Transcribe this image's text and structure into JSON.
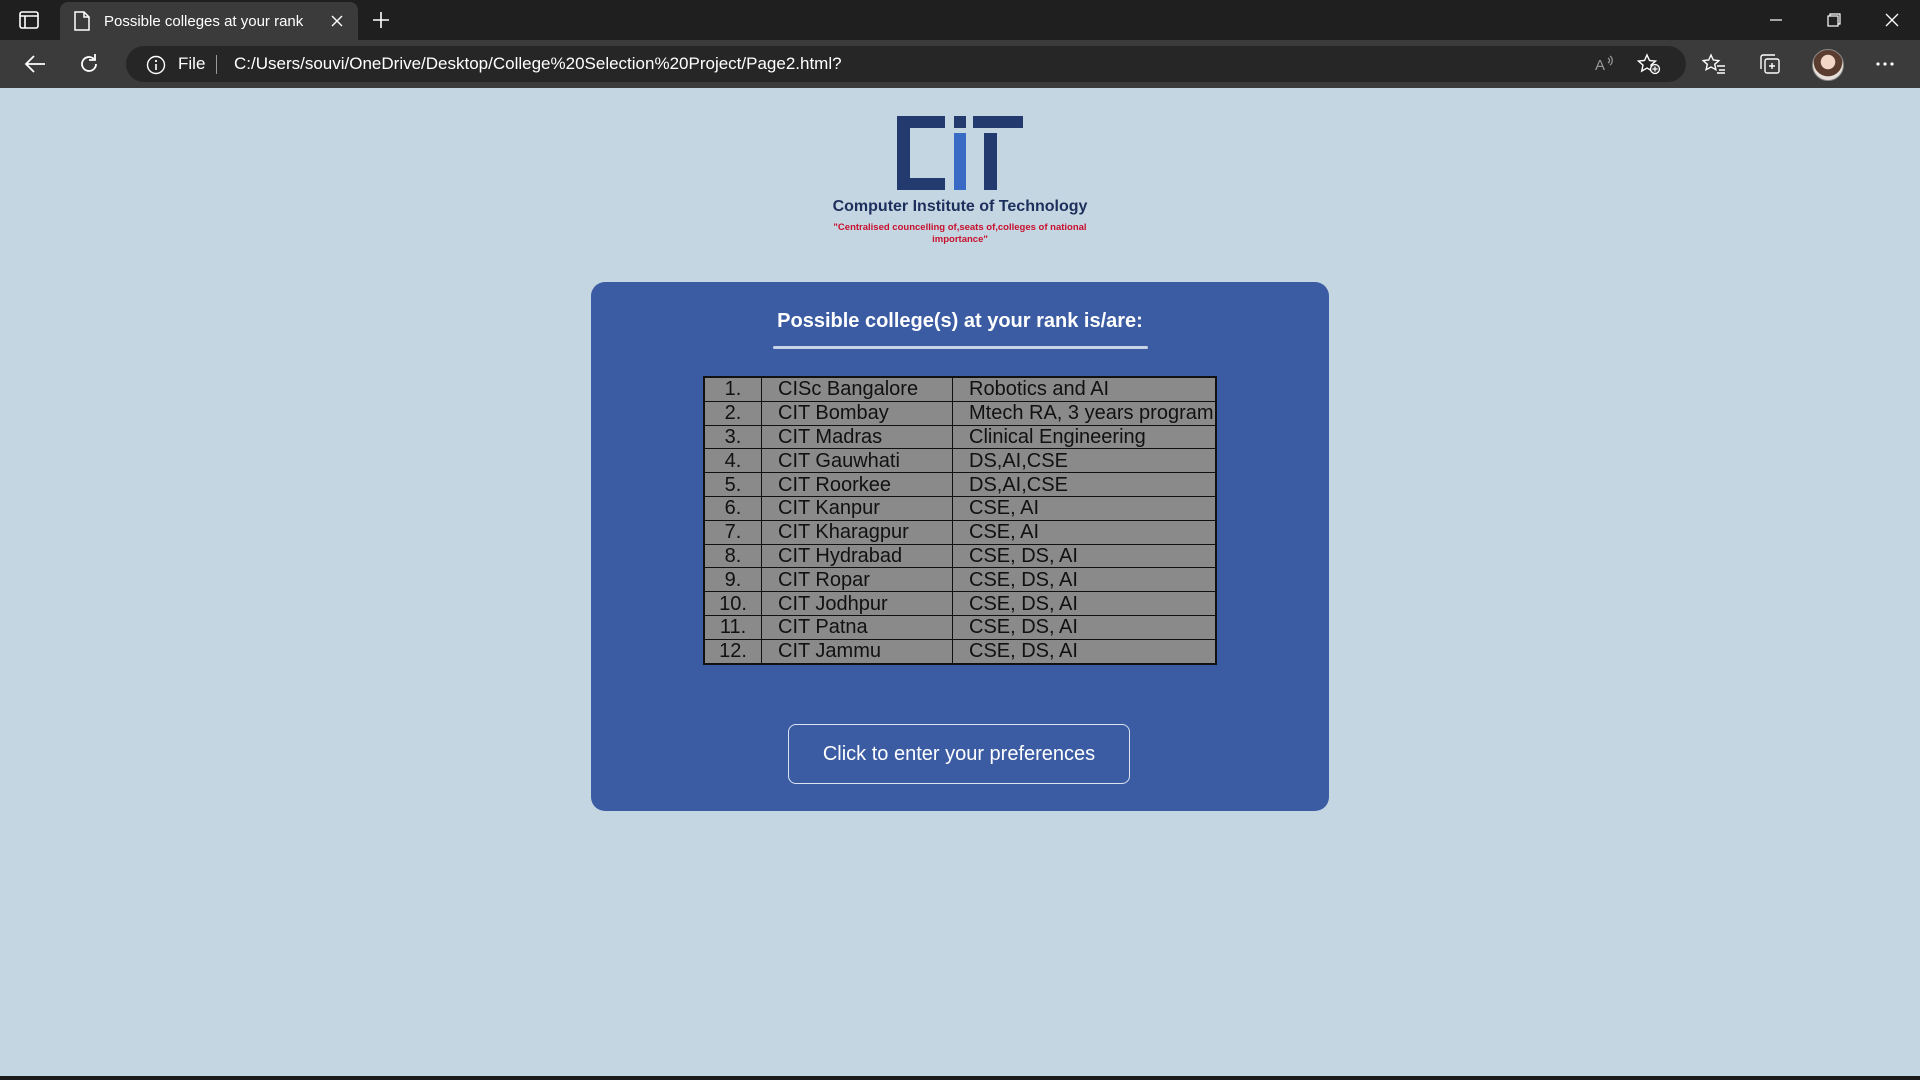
{
  "browser": {
    "tab_title": "Possible colleges at your rank",
    "address_prefix": "File",
    "url": "C:/Users/souvi/OneDrive/Desktop/College%20Selection%20Project/Page2.html?"
  },
  "logo": {
    "mark_color": "#233a6e",
    "name": "Computer Institute of Technology",
    "tagline": "\"Centralised councelling of,seats of,colleges of national importance\""
  },
  "card": {
    "heading": "Possible college(s) at your rank is/are:",
    "rows": [
      {
        "num": "1.",
        "college": "CISc Bangalore",
        "branch": "Robotics and AI"
      },
      {
        "num": "2.",
        "college": "CIT Bombay",
        "branch": "Mtech RA, 3 years program"
      },
      {
        "num": "3.",
        "college": "CIT Madras",
        "branch": "Clinical Engineering"
      },
      {
        "num": "4.",
        "college": "CIT Gauwhati",
        "branch": "DS,AI,CSE"
      },
      {
        "num": "5.",
        "college": "CIT Roorkee",
        "branch": "DS,AI,CSE"
      },
      {
        "num": "6.",
        "college": "CIT Kanpur",
        "branch": "CSE, AI"
      },
      {
        "num": "7.",
        "college": "CIT Kharagpur",
        "branch": "CSE, AI"
      },
      {
        "num": "8.",
        "college": "CIT Hydrabad",
        "branch": "CSE, DS, AI"
      },
      {
        "num": "9.",
        "college": "CIT Ropar",
        "branch": "CSE, DS, AI"
      },
      {
        "num": "10.",
        "college": "CIT Jodhpur",
        "branch": "CSE, DS, AI"
      },
      {
        "num": "11.",
        "college": "CIT Patna",
        "branch": "CSE, DS, AI"
      },
      {
        "num": "12.",
        "college": "CIT Jammu",
        "branch": "CSE, DS, AI"
      }
    ],
    "button_label": "Click to enter your preferences"
  },
  "colors": {
    "page_bg": "#c4d6e1",
    "card_bg": "#3b5ca3",
    "table_bg": "#8a8a8a",
    "tagline": "#c8102e"
  }
}
